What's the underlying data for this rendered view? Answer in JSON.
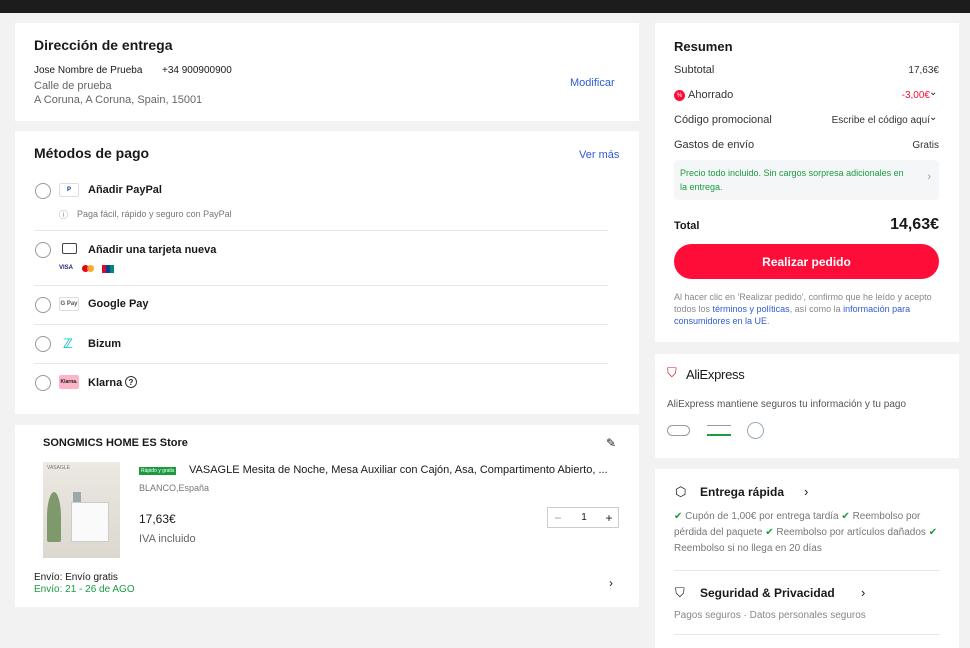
{
  "address": {
    "title": "Dirección de entrega",
    "name": "Jose Nombre de Prueba",
    "phone": "+34 900900900",
    "street": "Calle de prueba",
    "city": "A Coruna, A Coruna, Spain, 15001",
    "edit_label": "Modificar"
  },
  "payment": {
    "title": "Métodos de pago",
    "see_more": "Ver más",
    "methods": [
      {
        "label": "Añadir PayPal",
        "sub": "Paga fácil, rápido y seguro con PayPal",
        "icon": "paypal-icon"
      },
      {
        "label": "Añadir una tarjeta nueva",
        "icon": "card-icon",
        "cards": [
          "VISA",
          "MC",
          "UP"
        ]
      },
      {
        "label": "Google Pay",
        "icon": "google-pay-icon",
        "icon_text": "G Pay"
      },
      {
        "label": "Bizum",
        "icon": "bizum-icon"
      },
      {
        "label": "Klarna",
        "icon": "klarna-icon",
        "icon_text": "Klarna."
      }
    ]
  },
  "store": {
    "name": "SONGMICS HOME ES Store",
    "badge": "Rápido y gratis",
    "product_title": "VASAGLE Mesita de Noche, Mesa Auxiliar con Cajón, Asa, Compartimento Abierto, ...",
    "variant": "BLANCO,España",
    "price": "17,63€",
    "vat": "IVA incluido",
    "quantity": "1",
    "thumb_brand": "VASAGLE",
    "shipping_label": "Envío: Envío gratis",
    "shipping_dates": "Envío: 21 - 26 de AGO"
  },
  "summary": {
    "title": "Resumen",
    "subtotal_label": "Subtotal",
    "subtotal_value": "17,63€",
    "saved_label": "Ahorrado",
    "saved_value": "-3,00€",
    "promo_label": "Código promocional",
    "promo_value": "Escribe el código aquí",
    "shipping_label": "Gastos de envío",
    "shipping_value": "Gratis",
    "note": "Precio todo incluido. Sin cargos sorpresa adicionales en la entrega.",
    "total_label": "Total",
    "total_value": "14,63€",
    "button": "Realizar pedido",
    "legal_1": "Al hacer clic en 'Realizar pedido', confirmo que he leído y acepto todos los",
    "legal_link_1": "términos y políticas",
    "legal_2": ", así como la",
    "legal_link_2": "información para consumidores en la UE",
    "legal_3": "."
  },
  "aliexpress": {
    "brand": "AliExpress",
    "text": "AliExpress mantiene seguros tu información y tu pago"
  },
  "fast_delivery": {
    "title": "Entrega rápida",
    "items": [
      "Cupón de 1,00€ por entrega tardía",
      "Reembolso por pérdida del paquete",
      "Reembolso por artículos dañados",
      "Reembolso si no llega en 20 días"
    ],
    "security_title": "Seguridad & Privacidad",
    "security_text": "Pagos seguros · Datos personales seguros"
  },
  "colors": {
    "accent": "#fd0d37",
    "link": "#2e5bd8",
    "green": "#1a9c3e"
  }
}
